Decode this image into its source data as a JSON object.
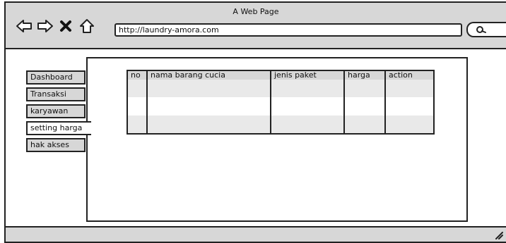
{
  "window": {
    "title": "A Web Page"
  },
  "toolbar": {
    "url": "http://laundry-amora.com"
  },
  "sidebar": {
    "items": [
      {
        "label": "Dashboard"
      },
      {
        "label": "Transaksi"
      },
      {
        "label": "karyawan"
      },
      {
        "label": "setting harga",
        "active": true
      },
      {
        "label": "hak akses"
      }
    ]
  },
  "table": {
    "columns": [
      "no",
      "nama barang cucia",
      "jenis paket",
      "harga",
      "action"
    ],
    "rows": [
      [
        "",
        "",
        "",
        "",
        ""
      ],
      [
        "",
        "",
        "",
        "",
        ""
      ],
      [
        "",
        "",
        "",
        "",
        ""
      ]
    ]
  },
  "icons": {
    "back": "back-arrow-icon",
    "forward": "forward-arrow-icon",
    "stop": "close-icon",
    "home": "home-icon",
    "search": "search-icon",
    "resize": "resize-grip-icon"
  },
  "colors": {
    "chrome": "#d7d7d7",
    "stripe": "#e9e9e9",
    "ink": "#222222"
  }
}
